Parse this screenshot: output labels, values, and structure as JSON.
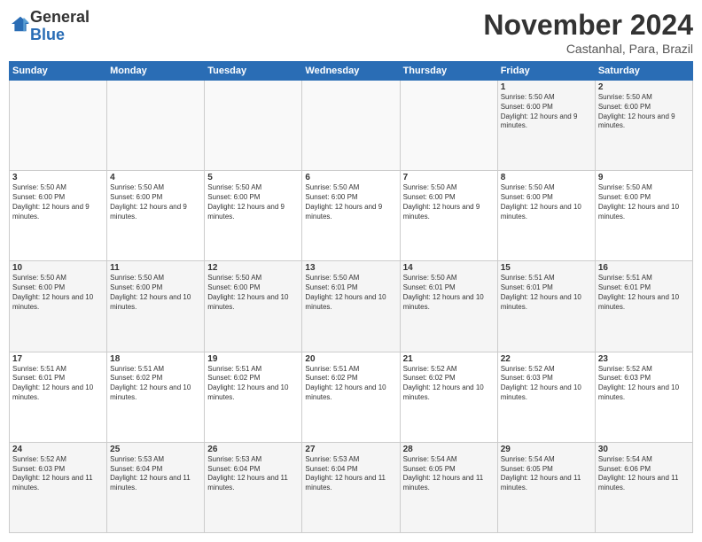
{
  "header": {
    "logo": {
      "line1": "General",
      "line2": "Blue"
    },
    "month": "November 2024",
    "location": "Castanhal, Para, Brazil"
  },
  "days_of_week": [
    "Sunday",
    "Monday",
    "Tuesday",
    "Wednesday",
    "Thursday",
    "Friday",
    "Saturday"
  ],
  "weeks": [
    [
      {
        "day": "",
        "info": ""
      },
      {
        "day": "",
        "info": ""
      },
      {
        "day": "",
        "info": ""
      },
      {
        "day": "",
        "info": ""
      },
      {
        "day": "",
        "info": ""
      },
      {
        "day": "1",
        "info": "Sunrise: 5:50 AM\nSunset: 6:00 PM\nDaylight: 12 hours and 9 minutes."
      },
      {
        "day": "2",
        "info": "Sunrise: 5:50 AM\nSunset: 6:00 PM\nDaylight: 12 hours and 9 minutes."
      }
    ],
    [
      {
        "day": "3",
        "info": "Sunrise: 5:50 AM\nSunset: 6:00 PM\nDaylight: 12 hours and 9 minutes."
      },
      {
        "day": "4",
        "info": "Sunrise: 5:50 AM\nSunset: 6:00 PM\nDaylight: 12 hours and 9 minutes."
      },
      {
        "day": "5",
        "info": "Sunrise: 5:50 AM\nSunset: 6:00 PM\nDaylight: 12 hours and 9 minutes."
      },
      {
        "day": "6",
        "info": "Sunrise: 5:50 AM\nSunset: 6:00 PM\nDaylight: 12 hours and 9 minutes."
      },
      {
        "day": "7",
        "info": "Sunrise: 5:50 AM\nSunset: 6:00 PM\nDaylight: 12 hours and 9 minutes."
      },
      {
        "day": "8",
        "info": "Sunrise: 5:50 AM\nSunset: 6:00 PM\nDaylight: 12 hours and 10 minutes."
      },
      {
        "day": "9",
        "info": "Sunrise: 5:50 AM\nSunset: 6:00 PM\nDaylight: 12 hours and 10 minutes."
      }
    ],
    [
      {
        "day": "10",
        "info": "Sunrise: 5:50 AM\nSunset: 6:00 PM\nDaylight: 12 hours and 10 minutes."
      },
      {
        "day": "11",
        "info": "Sunrise: 5:50 AM\nSunset: 6:00 PM\nDaylight: 12 hours and 10 minutes."
      },
      {
        "day": "12",
        "info": "Sunrise: 5:50 AM\nSunset: 6:00 PM\nDaylight: 12 hours and 10 minutes."
      },
      {
        "day": "13",
        "info": "Sunrise: 5:50 AM\nSunset: 6:01 PM\nDaylight: 12 hours and 10 minutes."
      },
      {
        "day": "14",
        "info": "Sunrise: 5:50 AM\nSunset: 6:01 PM\nDaylight: 12 hours and 10 minutes."
      },
      {
        "day": "15",
        "info": "Sunrise: 5:51 AM\nSunset: 6:01 PM\nDaylight: 12 hours and 10 minutes."
      },
      {
        "day": "16",
        "info": "Sunrise: 5:51 AM\nSunset: 6:01 PM\nDaylight: 12 hours and 10 minutes."
      }
    ],
    [
      {
        "day": "17",
        "info": "Sunrise: 5:51 AM\nSunset: 6:01 PM\nDaylight: 12 hours and 10 minutes."
      },
      {
        "day": "18",
        "info": "Sunrise: 5:51 AM\nSunset: 6:02 PM\nDaylight: 12 hours and 10 minutes."
      },
      {
        "day": "19",
        "info": "Sunrise: 5:51 AM\nSunset: 6:02 PM\nDaylight: 12 hours and 10 minutes."
      },
      {
        "day": "20",
        "info": "Sunrise: 5:51 AM\nSunset: 6:02 PM\nDaylight: 12 hours and 10 minutes."
      },
      {
        "day": "21",
        "info": "Sunrise: 5:52 AM\nSunset: 6:02 PM\nDaylight: 12 hours and 10 minutes."
      },
      {
        "day": "22",
        "info": "Sunrise: 5:52 AM\nSunset: 6:03 PM\nDaylight: 12 hours and 10 minutes."
      },
      {
        "day": "23",
        "info": "Sunrise: 5:52 AM\nSunset: 6:03 PM\nDaylight: 12 hours and 10 minutes."
      }
    ],
    [
      {
        "day": "24",
        "info": "Sunrise: 5:52 AM\nSunset: 6:03 PM\nDaylight: 12 hours and 11 minutes."
      },
      {
        "day": "25",
        "info": "Sunrise: 5:53 AM\nSunset: 6:04 PM\nDaylight: 12 hours and 11 minutes."
      },
      {
        "day": "26",
        "info": "Sunrise: 5:53 AM\nSunset: 6:04 PM\nDaylight: 12 hours and 11 minutes."
      },
      {
        "day": "27",
        "info": "Sunrise: 5:53 AM\nSunset: 6:04 PM\nDaylight: 12 hours and 11 minutes."
      },
      {
        "day": "28",
        "info": "Sunrise: 5:54 AM\nSunset: 6:05 PM\nDaylight: 12 hours and 11 minutes."
      },
      {
        "day": "29",
        "info": "Sunrise: 5:54 AM\nSunset: 6:05 PM\nDaylight: 12 hours and 11 minutes."
      },
      {
        "day": "30",
        "info": "Sunrise: 5:54 AM\nSunset: 6:06 PM\nDaylight: 12 hours and 11 minutes."
      }
    ]
  ]
}
